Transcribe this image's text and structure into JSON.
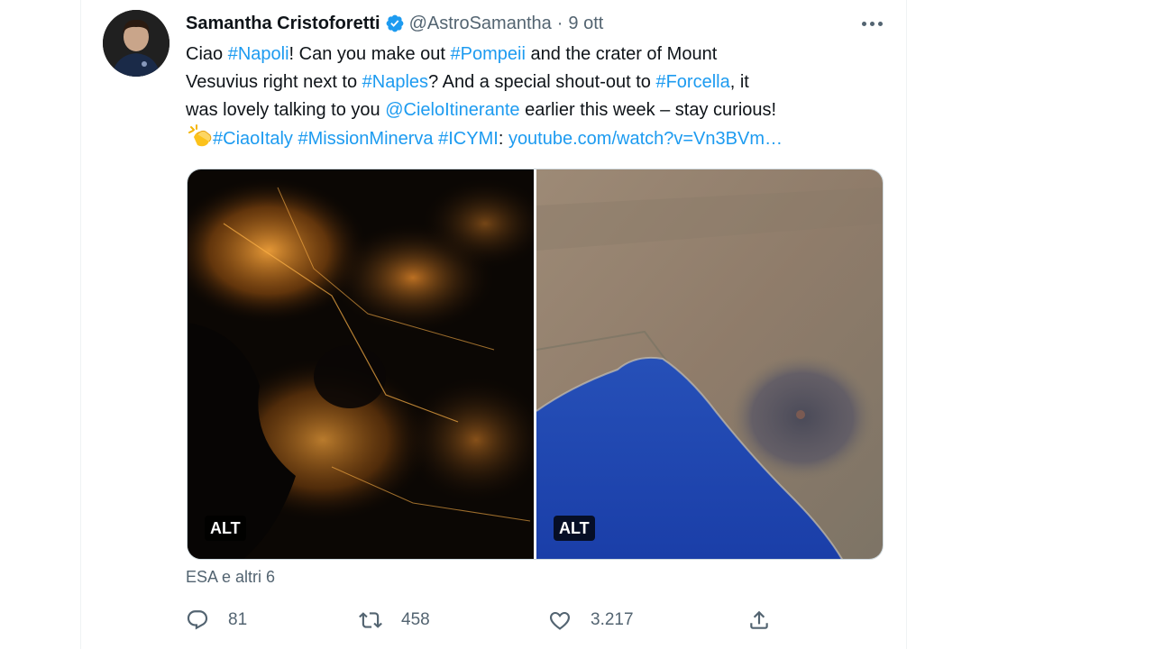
{
  "tweet": {
    "author": {
      "name": "Samantha Cristoforetti",
      "handle": "@AstroSamantha",
      "verified": true,
      "avatar_icon": "avatar-photo"
    },
    "separator": "·",
    "date": "9 ott",
    "text_lines": [
      [
        {
          "text": "Ciao ",
          "type": "text"
        },
        {
          "text": "#Napoli",
          "type": "hashtag"
        },
        {
          "text": "! Can you make out ",
          "type": "text"
        },
        {
          "text": "#Pompeii",
          "type": "hashtag"
        },
        {
          "text": " and the crater of Mount",
          "type": "text"
        }
      ],
      [
        {
          "text": "Vesuvius right next to ",
          "type": "text"
        },
        {
          "text": "#Naples",
          "type": "hashtag"
        },
        {
          "text": "? And a special shout-out to ",
          "type": "text"
        },
        {
          "text": "#Forcella",
          "type": "hashtag"
        },
        {
          "text": ", it",
          "type": "text"
        }
      ],
      [
        {
          "text": "was lovely talking to you ",
          "type": "text"
        },
        {
          "text": "@CieloItinerante",
          "type": "mention"
        },
        {
          "text": " earlier this week – stay curious!",
          "type": "text"
        }
      ],
      [
        {
          "text": "#CiaoItaly",
          "type": "hashtag"
        },
        {
          "text": " ",
          "type": "text"
        },
        {
          "text": "#MissionMinerva",
          "type": "hashtag"
        },
        {
          "text": " ",
          "type": "text"
        },
        {
          "text": "#ICYMI",
          "type": "hashtag"
        },
        {
          "text": ": ",
          "type": "text"
        },
        {
          "text": "youtube.com/watch?v=Vn3BVm…",
          "type": "url"
        }
      ]
    ],
    "media": [
      {
        "alt_label": "ALT",
        "icon": "night-city-photo"
      },
      {
        "alt_label": "ALT",
        "icon": "day-bay-photo"
      }
    ],
    "tagged_users": "ESA e altri 6",
    "actions": {
      "reply": {
        "count": "81",
        "icon": "reply-icon"
      },
      "retweet": {
        "count": "458",
        "icon": "retweet-icon"
      },
      "like": {
        "count": "3.217",
        "icon": "heart-icon"
      },
      "share": {
        "icon": "share-icon"
      }
    }
  },
  "colors": {
    "link": "#1d9bf0",
    "text": "#0f1419",
    "secondary": "#536471",
    "verified": "#1d9bf0"
  }
}
